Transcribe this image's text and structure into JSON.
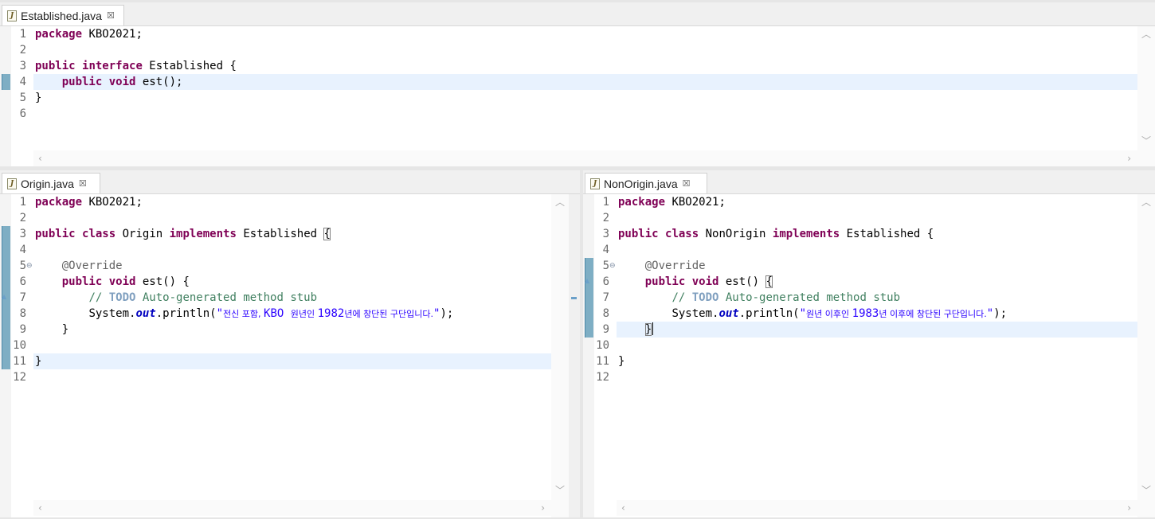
{
  "editors": {
    "established": {
      "tab": {
        "icon": "java-file-icon",
        "title": "Established.java",
        "close": "☒"
      },
      "line_numbers": [
        "1",
        "2",
        "3",
        "4",
        "5",
        "6"
      ],
      "code": {
        "l1_kw": "package",
        "l1_rest": " KBO2021;",
        "l3_kw1": "public",
        "l3_kw2": "interface",
        "l3_rest": " Established {",
        "l4_indent": "    ",
        "l4_kw1": "public",
        "l4_kw2": "void",
        "l4_rest": " est();",
        "l5": "}"
      }
    },
    "origin": {
      "tab": {
        "icon": "java-file-icon",
        "title": "Origin.java",
        "close": "☒"
      },
      "line_numbers": [
        "1",
        "2",
        "3",
        "4",
        "5",
        "6",
        "7",
        "8",
        "9",
        "10",
        "11",
        "12"
      ],
      "fold_glyph": "⊖",
      "code": {
        "l1_kw": "package",
        "l1_rest": " KBO2021;",
        "l3_kw1": "public",
        "l3_kw2": "class",
        "l3_name": " Origin ",
        "l3_kw3": "implements",
        "l3_rest": " Established ",
        "l3_brace": "{",
        "l5_ann": "@Override",
        "l6_kw1": "public",
        "l6_kw2": "void",
        "l6_rest": " est() {",
        "l7_cm1": "// ",
        "l7_todo": "TODO",
        "l7_cm2": " Auto-generated method stub",
        "l8_a": "System.",
        "l8_fld": "out",
        "l8_b": ".println(",
        "l8_q1": "\"",
        "l8_s1": "전신 포함, ",
        "l8_s2": "KBO ",
        "l8_s3": "원년인 ",
        "l8_s4": "1982",
        "l8_s5": "년에 창단된 구단입니다.",
        "l8_q2": "\"",
        "l8_end": ");",
        "l9": "}",
        "l11": "}"
      }
    },
    "nonorigin": {
      "tab": {
        "icon": "java-file-icon",
        "title": "NonOrigin.java",
        "close": "☒"
      },
      "line_numbers": [
        "1",
        "2",
        "3",
        "4",
        "5",
        "6",
        "7",
        "8",
        "9",
        "10",
        "11",
        "12"
      ],
      "fold_glyph": "⊖",
      "code": {
        "l1_kw": "package",
        "l1_rest": " KBO2021;",
        "l3_kw1": "public",
        "l3_kw2": "class",
        "l3_name": " NonOrigin ",
        "l3_kw3": "implements",
        "l3_rest": " Established {",
        "l5_ann": "@Override",
        "l6_kw1": "public",
        "l6_kw2": "void",
        "l6_rest": " est() ",
        "l6_brace": "{",
        "l7_cm1": "// ",
        "l7_todo": "TODO",
        "l7_cm2": " Auto-generated method stub",
        "l8_a": "System.",
        "l8_fld": "out",
        "l8_b": ".println(",
        "l8_q1": "\"",
        "l8_s1": "원년 이후인 ",
        "l8_s2": "1983",
        "l8_s3": "년 이후에 창단된 구단입니다.",
        "l8_q2": "\"",
        "l8_end": ");",
        "l9_brace": "}",
        "l11": "}"
      }
    }
  },
  "scroll_arrows": {
    "up": "︿",
    "down": "﹀",
    "left": "‹",
    "right": "›"
  },
  "colors": {
    "keyword": "#7f0055",
    "string": "#2a00ff",
    "comment": "#3f7f5f",
    "todo": "#7f9fbf",
    "field": "#0000c0",
    "current_line": "#e8f2fe"
  }
}
